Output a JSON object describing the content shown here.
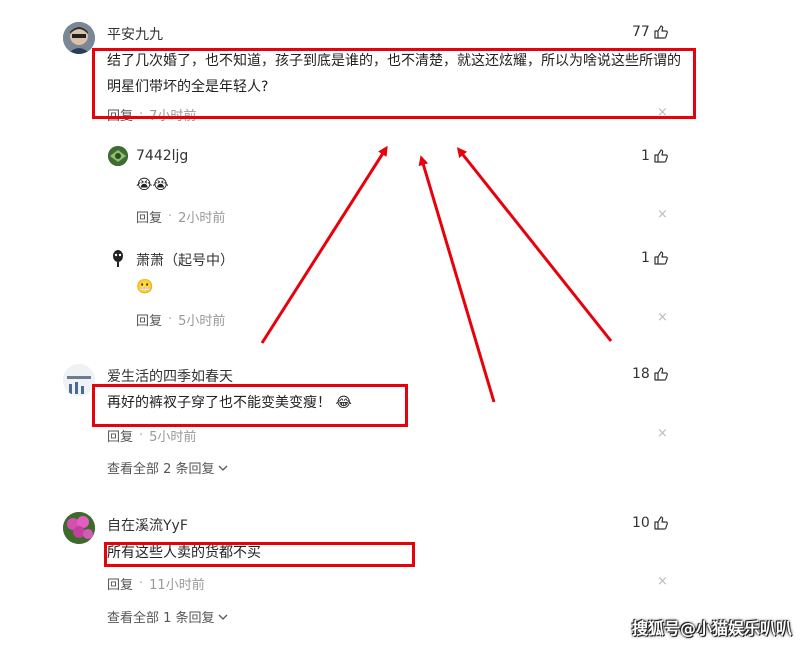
{
  "comments": [
    {
      "user": "平安九九",
      "likes": "77",
      "text": "结了几次婚了，也不知道，孩子到底是谁的，也不清楚，就这还炫耀，所以为啥说这些所谓的明星们带坏的全是年轻人?",
      "reply_label": "回复",
      "dot": "·",
      "time": "7小时前",
      "close": "×",
      "replies": [
        {
          "user": "7442ljg",
          "likes": "1",
          "text": "😭😭",
          "reply_label": "回复",
          "dot": "·",
          "time": "2小时前",
          "close": "×"
        },
        {
          "user": "萧萧（起号中）",
          "likes": "1",
          "text": "😬",
          "reply_label": "回复",
          "dot": "·",
          "time": "5小时前",
          "close": "×"
        }
      ]
    },
    {
      "user": "爱生活的四季如春天",
      "likes": "18",
      "text": "再好的裤衩子穿了也不能变美变瘦！",
      "emoji": "😂",
      "reply_label": "回复",
      "dot": "·",
      "time": "5小时前",
      "close": "×",
      "view_all": "查看全部 2 条回复"
    },
    {
      "user": "自在溪流YyF",
      "likes": "10",
      "text": "所有这些人卖的货都不买",
      "reply_label": "回复",
      "dot": "·",
      "time": "11小时前",
      "close": "×",
      "view_all": "查看全部 1 条回复"
    }
  ],
  "watermark": "搜狐号@小猫娱乐叭叭",
  "colors": {
    "highlight": "#e8000b",
    "meta": "#999999"
  },
  "icons": {
    "like": "thumbs-up-icon",
    "close": "close-icon",
    "expand": "chevron-down-icon"
  }
}
